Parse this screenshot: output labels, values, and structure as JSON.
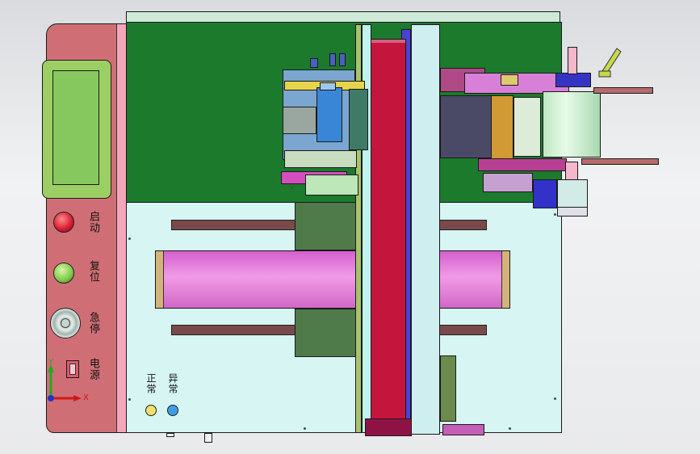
{
  "panel": {
    "labels": {
      "start": "启动",
      "reset": "复位",
      "estop": "急停",
      "power": "电源",
      "normal": "正常",
      "abnormal": "异常"
    }
  },
  "axes": {
    "x": "X",
    "y": "Y"
  },
  "colors": {
    "background": "#e6e7e9",
    "control_panel": "#cf6f75",
    "machine_base": "#d6f5f3",
    "green_plate": "#1c7a2c",
    "red_carriage": "#c4163c",
    "magenta_roller": "#e46fd8",
    "hmi_screen": "#8fd06c"
  },
  "icons": {
    "start_button": "red-push-button",
    "reset_button": "green-push-button",
    "estop_button": "emergency-stop-icon",
    "power_switch": "power-switch-icon",
    "normal_lamp": "yellow-indicator-lamp",
    "abnormal_lamp": "blue-indicator-lamp",
    "triad": "coordinate-triad-icon"
  }
}
